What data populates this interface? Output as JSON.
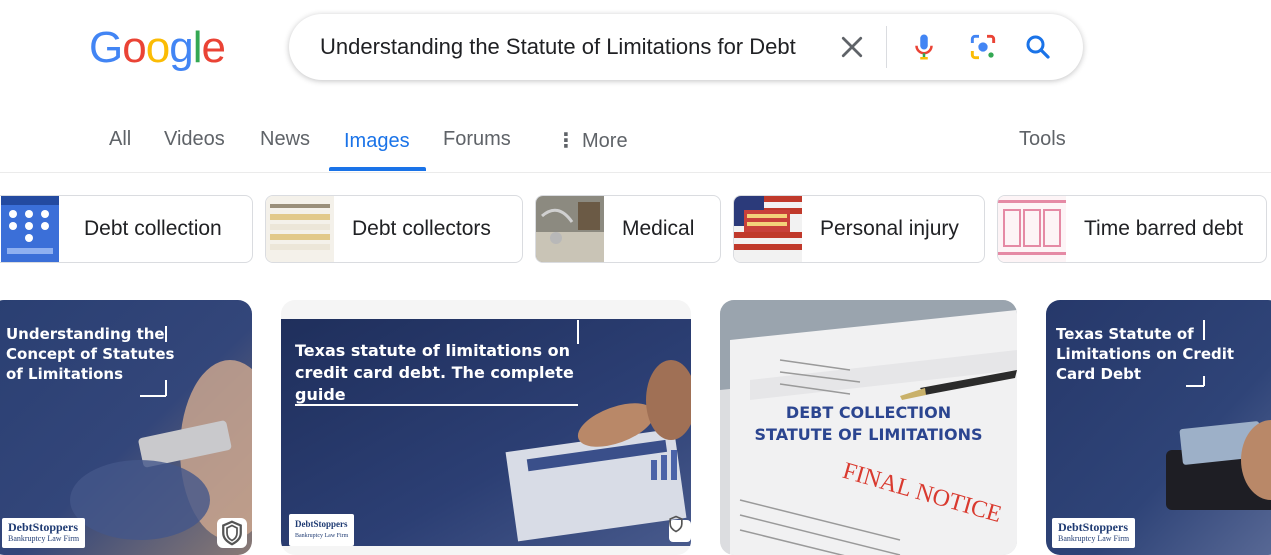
{
  "logo": {
    "letters": [
      "G",
      "o",
      "o",
      "g",
      "l",
      "e"
    ],
    "colors": [
      "#4285F4",
      "#EA4335",
      "#FBBC05",
      "#4285F4",
      "#34A853",
      "#EA4335"
    ]
  },
  "search": {
    "query": "Understanding the Statute of Limitations for Debt",
    "icons": [
      "clear-icon",
      "microphone-icon",
      "camera-lens-icon",
      "search-icon"
    ]
  },
  "tabs": {
    "all": "All",
    "videos": "Videos",
    "news": "News",
    "images": "Images",
    "forums": "Forums",
    "more": "More",
    "more_glyph": "⋮",
    "tools": "Tools"
  },
  "chips": [
    {
      "label": "Debt collection"
    },
    {
      "label": "Debt collectors"
    },
    {
      "label": "Medical"
    },
    {
      "label": "Personal injury"
    },
    {
      "label": "Time barred debt"
    }
  ],
  "results": [
    {
      "overlay": "Understanding the Concept of Statutes of Limitations",
      "brand1": "DebtStoppers",
      "brand2": "Bankruptcy Law Firm"
    },
    {
      "overlay": "Texas statute of limitations on credit card debt. The complete guide",
      "brand1": "DebtStoppers",
      "brand2": "Bankruptcy Law Firm"
    },
    {
      "headline1": "DEBT COLLECTION",
      "headline2": "STATUTE OF LIMITATIONS",
      "stamp": "FINAL NOTICE"
    },
    {
      "overlay": "Texas Statute of Limitations on Credit Card Debt",
      "brand1": "DebtStoppers",
      "brand2": "Bankruptcy Law Firm"
    }
  ],
  "colors": {
    "accent": "#1a73e8",
    "tab_inactive": "#5f6368",
    "navy": "#1f3b73"
  }
}
